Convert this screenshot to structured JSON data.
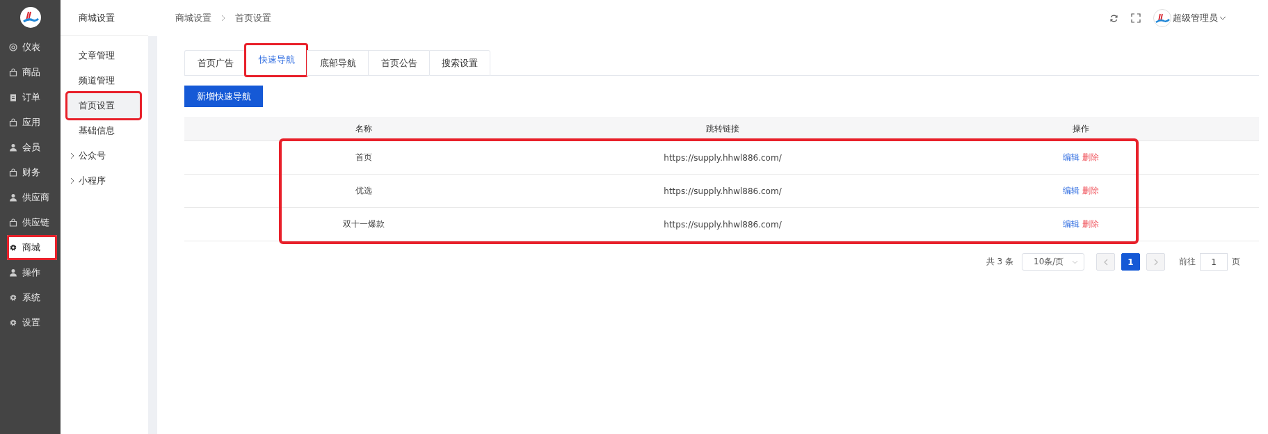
{
  "sidebar": {
    "items": [
      {
        "label": "仪表",
        "kind": "dial",
        "selected": false,
        "highlighted": false
      },
      {
        "label": "商品",
        "kind": "bag",
        "selected": false,
        "highlighted": false
      },
      {
        "label": "订单",
        "kind": "clipboard",
        "selected": false,
        "highlighted": false
      },
      {
        "label": "应用",
        "kind": "bag",
        "selected": false,
        "highlighted": false
      },
      {
        "label": "会员",
        "kind": "person",
        "selected": false,
        "highlighted": false
      },
      {
        "label": "财务",
        "kind": "bag",
        "selected": false,
        "highlighted": false
      },
      {
        "label": "供应商",
        "kind": "person",
        "selected": false,
        "highlighted": false
      },
      {
        "label": "供应链",
        "kind": "bag",
        "selected": false,
        "highlighted": false
      },
      {
        "label": "商城",
        "kind": "gear",
        "selected": true,
        "highlighted": true
      },
      {
        "label": "操作",
        "kind": "person",
        "selected": false,
        "highlighted": false
      },
      {
        "label": "系统",
        "kind": "gear",
        "selected": false,
        "highlighted": false
      },
      {
        "label": "设置",
        "kind": "gear",
        "selected": false,
        "highlighted": false
      }
    ]
  },
  "submenu": {
    "title": "商城设置",
    "items": [
      {
        "label": "文章管理",
        "selected": false,
        "highlighted": false,
        "expandable": false
      },
      {
        "label": "频道管理",
        "selected": false,
        "highlighted": false,
        "expandable": false
      },
      {
        "label": "首页设置",
        "selected": true,
        "highlighted": true,
        "expandable": false
      },
      {
        "label": "基础信息",
        "selected": false,
        "highlighted": false,
        "expandable": false
      },
      {
        "label": "公众号",
        "selected": false,
        "highlighted": false,
        "expandable": true
      },
      {
        "label": "小程序",
        "selected": false,
        "highlighted": false,
        "expandable": true
      }
    ]
  },
  "breadcrumb": [
    "商城设置",
    "首页设置"
  ],
  "user": {
    "name": "超级管理员"
  },
  "tabs": [
    {
      "label": "首页广告",
      "selected": false,
      "highlighted": false
    },
    {
      "label": "快速导航",
      "selected": true,
      "highlighted": true
    },
    {
      "label": "底部导航",
      "selected": false,
      "highlighted": false
    },
    {
      "label": "首页公告",
      "selected": false,
      "highlighted": false
    },
    {
      "label": "搜索设置",
      "selected": false,
      "highlighted": false
    }
  ],
  "add_button": "新增快速导航",
  "table": {
    "columns": [
      "名称",
      "跳转链接",
      "操作"
    ],
    "rows_highlighted": true,
    "rows": [
      {
        "name": "首页",
        "link": "https://supply.hhwl886.com/",
        "actions": [
          "编辑",
          "删除"
        ]
      },
      {
        "name": "优选",
        "link": "https://supply.hhwl886.com/",
        "actions": [
          "编辑",
          "删除"
        ]
      },
      {
        "name": "双十一爆款",
        "link": "https://supply.hhwl886.com/",
        "actions": [
          "编辑",
          "删除"
        ]
      }
    ]
  },
  "pagination": {
    "total": "共 3 条",
    "page_size": "10条/页",
    "pages": [
      {
        "label": "1",
        "selected": true
      }
    ],
    "goto_label": "前往",
    "goto_value": "1",
    "goto_suffix": "页"
  }
}
